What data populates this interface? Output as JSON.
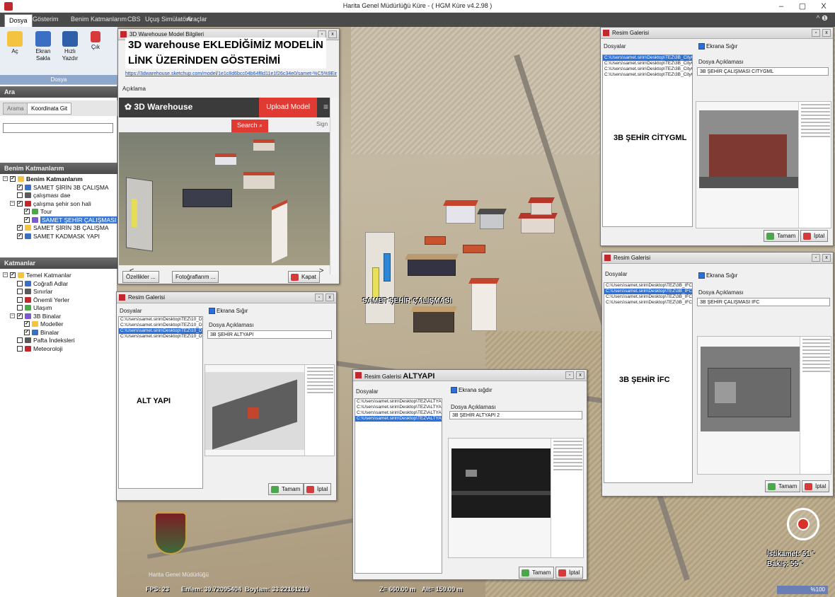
{
  "window": {
    "title": "Harita Genel Müdürlüğü Küre -  ( HGM Küre v4.2.98 )",
    "min": "–",
    "max": "▢",
    "close": "X"
  },
  "menu": {
    "items": [
      "Dosya",
      "Gösterim",
      "Benim Katmanlarım",
      "CBS",
      "Uçuş Simülatörü",
      "Araçlar"
    ],
    "collapse": "^ ❶"
  },
  "ribbon": {
    "buttons": [
      {
        "label": "Aç",
        "icon": "open-folder-icon"
      },
      {
        "label": "Ekran Sakla",
        "icon": "save-disk-icon"
      },
      {
        "label": "Hızlı Yazdır",
        "icon": "printer-icon"
      },
      {
        "label": "Çık",
        "icon": "exit-icon"
      }
    ],
    "group": "Dosya"
  },
  "search_panel": {
    "header": "Ara",
    "tabs": [
      "Arama",
      "Koordinata Git"
    ],
    "input_value": ""
  },
  "my_layers": {
    "header": "Benim Katmanlarım",
    "items": [
      {
        "label": "Benim Katmanlarım",
        "level": 0,
        "checked": true,
        "expanded": true,
        "bold": true
      },
      {
        "label": "SAMET ŞİRİN 3B ÇALIŞMA",
        "level": 1,
        "checked": true
      },
      {
        "label": "çalışması dae",
        "level": 1,
        "checked": false
      },
      {
        "label": "çalışma şehir son hali",
        "level": 1,
        "checked": true,
        "expanded": true
      },
      {
        "label": "Tour",
        "level": 2,
        "checked": true
      },
      {
        "label": "SAMET ŞEHİR ÇALIŞMASI",
        "level": 2,
        "checked": true,
        "selected": true
      },
      {
        "label": "SAMET ŞİRİN 3B ÇALIŞMA",
        "level": 1,
        "checked": true
      },
      {
        "label": "SAMET KADMASK YAPI",
        "level": 1,
        "checked": true
      }
    ]
  },
  "layers": {
    "header": "Katmanlar",
    "items": [
      {
        "label": "Temel Katmanlar",
        "level": 0,
        "checked": true,
        "expanded": true
      },
      {
        "label": "Coğrafi Adlar",
        "level": 1,
        "checked": false
      },
      {
        "label": "Sınırlar",
        "level": 1,
        "checked": false
      },
      {
        "label": "Önemli Yerler",
        "level": 1,
        "checked": false
      },
      {
        "label": "Ulaşım",
        "level": 1,
        "checked": false
      },
      {
        "label": "3B Binalar",
        "level": 1,
        "checked": true,
        "expanded": true
      },
      {
        "label": "Modeller",
        "level": 2,
        "checked": true
      },
      {
        "label": "Binalar",
        "level": 2,
        "checked": true
      },
      {
        "label": "Pafta İndeksleri",
        "level": 1,
        "checked": false
      },
      {
        "label": "Meteoroloji",
        "level": 1,
        "checked": false
      }
    ]
  },
  "warehouse_dialog": {
    "title": "3D Warehouse Model Bilgileri",
    "caption_line1": "3D warehouse EKLEDİĞİMİZ MODELİN",
    "caption_line2": "LİNK ÜZERİNDEN GÖSTERİMİ",
    "link": "https://3dwarehouse.sketchup.com/model/1e1c8d6bcc04b64f8d11e1f26c34e0/samet-%C5%9Eir",
    "desc_label": "Açıklama",
    "brand": "3D Warehouse",
    "upload": "Upload Model",
    "search": "Search",
    "signin": "Sign",
    "prev": "<",
    "next": ">",
    "buttons": [
      "Özellikler ...",
      "Fotoğraflarım ...",
      "Kapat"
    ]
  },
  "gallery_altyapi_left": {
    "title": "Resim Galerisi",
    "files_label": "Dosyalar",
    "files": [
      "C:\\Users\\samet.sirin\\Desktop\\TEZ\\10_DEM_kare.jpg",
      "C:\\Users\\samet.sirin\\Desktop\\TEZ\\10_DEM2_kare.jpg",
      "C:\\Users\\samet.sirin\\Desktop\\TEZ\\10_DEM3_kare.jpg",
      "C:\\Users\\samet.sirin\\Desktop\\TEZ\\10_DEM4_kare.jpg"
    ],
    "selected_index": 2,
    "caption": "ALT YAPI",
    "check_label": "Ekrana Sığır",
    "desc_label": "Dosya Açıklaması",
    "desc_value": "3B ŞEHİR ALTYAPI",
    "buttons": [
      "Tamam",
      "İptal"
    ]
  },
  "gallery_citygml": {
    "title": "Resim Galerisi",
    "files_label": "Dosyalar",
    "files": [
      "C:\\Users\\samet.sirin\\Desktop\\TEZ\\3B_CityGML1.jpg",
      "C:\\Users\\samet.sirin\\Desktop\\TEZ\\3B_CityGML2.jpg",
      "C:\\Users\\samet.sirin\\Desktop\\TEZ\\3B_CityGML3.jpg",
      "C:\\Users\\samet.sirin\\Desktop\\TEZ\\3B_CityGML4.jpg"
    ],
    "selected_index": 0,
    "caption": "3B ŞEHİR CİTYGML",
    "check_label": "Ekrana Sığır",
    "desc_label": "Dosya Açıklaması",
    "desc_value": "3B ŞEHİR ÇALIŞMASI CITYGML",
    "buttons": [
      "Tamam",
      "İptal"
    ]
  },
  "gallery_ifc": {
    "title": "Resim Galerisi",
    "files_label": "Dosyalar",
    "files": [
      "C:\\Users\\samet.sirin\\Desktop\\TEZ\\3B_IFC1.jpg",
      "C:\\Users\\samet.sirin\\Desktop\\TEZ\\3B_IFC2.jpg",
      "C:\\Users\\samet.sirin\\Desktop\\TEZ\\3B_IFC3.jpg",
      "C:\\Users\\samet.sirin\\Desktop\\TEZ\\3B_IFC4.jpg"
    ],
    "selected_index": 1,
    "caption": "3B ŞEHİR İFC",
    "check_label": "Ekrana Sığır",
    "desc_label": "Dosya Açıklaması",
    "desc_value": "3B ŞEHİR ÇALIŞMASI IFC",
    "buttons": [
      "Tamam",
      "İptal"
    ]
  },
  "gallery_altyapi_center": {
    "title": "Resim Galerisi",
    "caption": "ALTYAPI",
    "files_label": "Dosyalar",
    "files": [
      "C:\\Users\\samet.sirin\\Desktop\\TEZ\\ALTYAPI_1.jpg",
      "C:\\Users\\samet.sirin\\Desktop\\TEZ\\ALTYAPI_2.jpg",
      "C:\\Users\\samet.sirin\\Desktop\\TEZ\\ALTYAPI_3.jpg",
      "C:\\Users\\samet.sirin\\Desktop\\TEZ\\ALTYAPI_4.jpg"
    ],
    "selected_index": 3,
    "check_label": "Ekrana sığdır",
    "desc_label": "Dosya Açıklaması",
    "desc_value": "3B ŞEHİR ALTYAPI 2",
    "buttons": [
      "Tamam",
      "İptal"
    ]
  },
  "map": {
    "label_3d": "SAMET ŞEHİR ÇALIŞMASI",
    "logo_text": "Harita Genel Müdürlüğü",
    "fps": "FPS: 23",
    "lat": "Enlem: 39.72095404",
    "lon": "Boylam: 33.22161219",
    "zoom": "Z= 660.00 m",
    "alt": "Alt= 159.09 m",
    "heading": "İstikamet: 61 °",
    "tilt": "Bakış: 55 °",
    "zoom_pct": "%100"
  }
}
